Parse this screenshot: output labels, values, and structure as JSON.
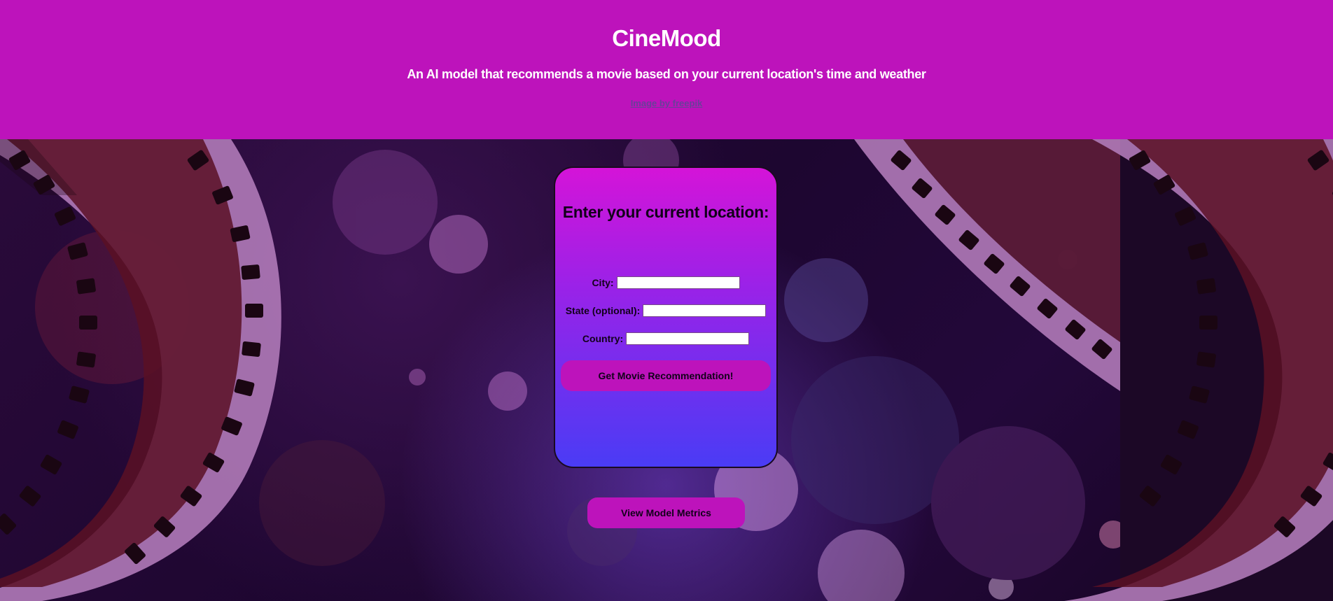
{
  "header": {
    "title": "CineMood",
    "subtitle": "An AI model that recommends a movie based on your current location's time and weather",
    "credit_link": "Image by freepik",
    "background_color": "#bd13bb"
  },
  "form": {
    "title": "Enter your current location:",
    "fields": [
      {
        "label": "City:",
        "value": ""
      },
      {
        "label": "State (optional):",
        "value": ""
      },
      {
        "label": "Country:",
        "value": ""
      }
    ],
    "submit_label": "Get Movie Recommendation!"
  },
  "metrics_button": {
    "label": "View Model Metrics"
  },
  "colors": {
    "accent": "#bd13bb",
    "card_gradient_top": "#d414d8",
    "card_gradient_bottom": "#4a3cf5",
    "link": "#6a3f9a"
  },
  "icons": {
    "background": "film-strip-bokeh-background"
  }
}
